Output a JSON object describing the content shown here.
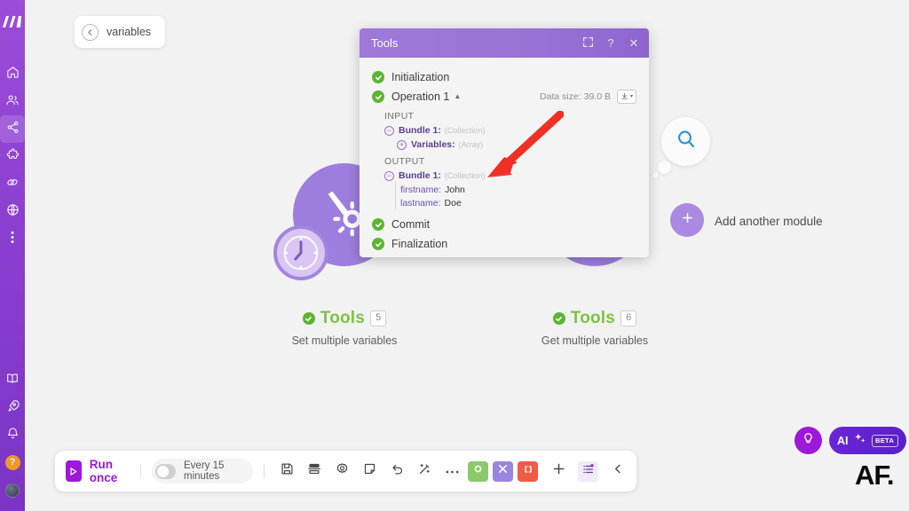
{
  "sidebar": {
    "logo": "make-logo",
    "items": [
      {
        "name": "home",
        "icon": "home-icon",
        "active": false
      },
      {
        "name": "organization",
        "icon": "users-icon",
        "active": false
      },
      {
        "name": "scenarios",
        "icon": "share-nodes-icon",
        "active": true
      },
      {
        "name": "templates",
        "icon": "puzzle-icon",
        "active": false
      },
      {
        "name": "connections",
        "icon": "link-icon",
        "active": false
      },
      {
        "name": "webhooks",
        "icon": "globe-icon",
        "active": false
      },
      {
        "name": "more",
        "icon": "ellipsis-vertical-icon",
        "active": false
      }
    ],
    "bottom_items": [
      {
        "name": "docs",
        "icon": "book-icon"
      },
      {
        "name": "whats-new",
        "icon": "rocket-icon"
      },
      {
        "name": "notifications",
        "icon": "bell-icon"
      },
      {
        "name": "help",
        "icon": "question-mark-icon"
      },
      {
        "name": "account",
        "icon": "avatar-icon"
      }
    ],
    "help_glyph": "?"
  },
  "breadcrumb": {
    "back_icon": "back-arrow-icon",
    "label": "variables"
  },
  "canvas": {
    "modules": [
      {
        "title": "Tools",
        "badge": "5",
        "subtitle": "Set multiple variables",
        "icon": "tools-icon",
        "status": "success",
        "has_clock": true,
        "selected": false
      },
      {
        "title": "Tools",
        "badge": "6",
        "subtitle": "Get multiple variables",
        "icon": "tools-icon",
        "status": "success",
        "has_clock": false,
        "selected": true
      }
    ],
    "search_bubble_icon": "search-icon",
    "add_module": {
      "icon": "plus-icon",
      "label": "Add another module"
    }
  },
  "panel": {
    "title": "Tools",
    "buttons": [
      {
        "name": "expand-button",
        "icon": "expand-icon",
        "glyph": "⤢"
      },
      {
        "name": "help-button",
        "icon": "question-mark-icon",
        "glyph": "?"
      },
      {
        "name": "close-button",
        "icon": "close-icon",
        "glyph": "✕"
      }
    ],
    "steps": [
      {
        "label": "Initialization",
        "status": "success",
        "expandable": false
      },
      {
        "label": "Operation 1",
        "status": "success",
        "expandable": true,
        "caret": "▲"
      },
      {
        "label": "Commit",
        "status": "success",
        "expandable": false
      },
      {
        "label": "Finalization",
        "status": "success",
        "expandable": false
      }
    ],
    "data_size_label": "Data size: 39.0 B",
    "download_icon": "download-icon",
    "download_caret": "▾",
    "input": {
      "section_label": "INPUT",
      "nodes": [
        {
          "key": "Bundle 1:",
          "type": "(Collection)",
          "toggle": "−",
          "depth": 0,
          "bold": true
        },
        {
          "key": "Variables:",
          "type": "(Array)",
          "toggle": "+",
          "depth": 1,
          "bold": true
        }
      ]
    },
    "output": {
      "section_label": "OUTPUT",
      "nodes": [
        {
          "key": "Bundle 1:",
          "type": "(Collection)",
          "toggle": "−",
          "depth": 0,
          "bold": true
        }
      ],
      "leaves": [
        {
          "key": "firstname:",
          "value": "John"
        },
        {
          "key": "lastname:",
          "value": "Doe"
        }
      ]
    }
  },
  "annotation": {
    "arrow_color": "#ee3124",
    "arrow_name": "red-arrow-pointing-to-output-bundle"
  },
  "toolbar": {
    "run_label": "Run once",
    "run_icon": "play-icon",
    "schedule_label": "Every 15 minutes",
    "schedule_enabled": false,
    "icons": [
      {
        "name": "save-button",
        "icon": "save-icon"
      },
      {
        "name": "align-button",
        "icon": "align-icon"
      },
      {
        "name": "settings-button",
        "icon": "gear-icon"
      },
      {
        "name": "notes-button",
        "icon": "note-icon"
      },
      {
        "name": "undo-button",
        "icon": "undo-icon"
      },
      {
        "name": "auto-align-button",
        "icon": "magic-wand-icon"
      },
      {
        "name": "more-button",
        "icon": "ellipsis-icon"
      }
    ],
    "color_buttons": [
      {
        "name": "explain-flow-button",
        "icon": "circle-icon",
        "color": "#8cc96a"
      },
      {
        "name": "tools-button",
        "icon": "tools-icon",
        "color": "#9a86de"
      },
      {
        "name": "brackets-button",
        "icon": "brackets-icon",
        "color": "#ef5b45"
      }
    ],
    "right_icons": [
      {
        "name": "add-module-button",
        "icon": "plus-icon"
      },
      {
        "name": "filters-button",
        "icon": "filter-list-icon"
      },
      {
        "name": "collapse-button",
        "icon": "chevron-left-icon"
      }
    ]
  },
  "widgets": {
    "bulb_icon": "lightbulb-icon",
    "ai_label": "AI",
    "ai_sparkle_icon": "sparkles-icon",
    "beta_label": "BETA",
    "watermark": "AF."
  }
}
